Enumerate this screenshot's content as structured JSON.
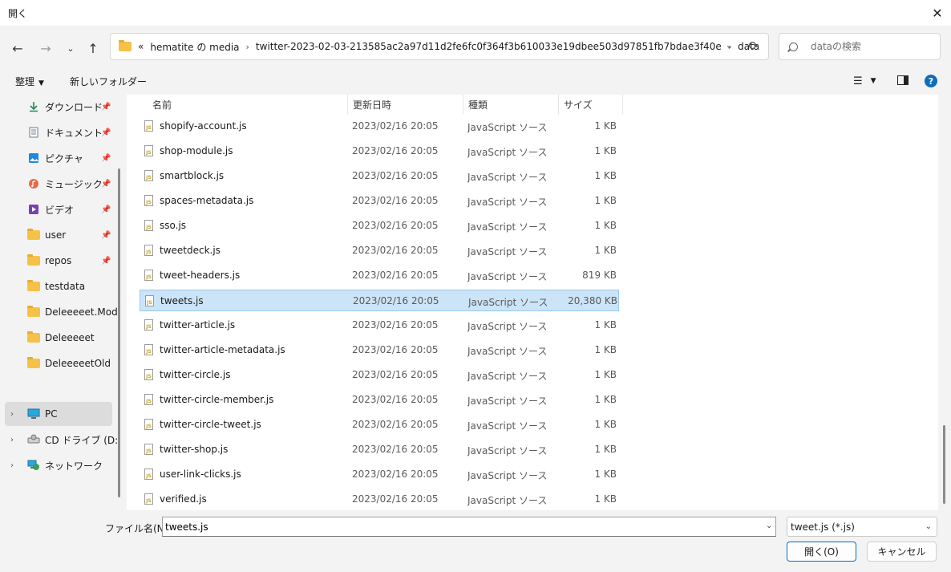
{
  "window": {
    "title": "開く"
  },
  "address": {
    "overflow": "«",
    "crumbs": [
      "hematite の media",
      "twitter-2023-02-03-213585ac2a97d11d2fe6fc0f364f3b610033e19dbee503d97851fb7bdae3f40e",
      "data"
    ]
  },
  "search": {
    "placeholder": "dataの検索"
  },
  "commands": {
    "organize": "整理",
    "new_folder": "新しいフォルダー"
  },
  "sidebar": {
    "items": [
      {
        "label": "ダウンロード",
        "icon": "download-icon",
        "pinned": true
      },
      {
        "label": "ドキュメント",
        "icon": "document-icon",
        "pinned": true
      },
      {
        "label": "ピクチャ",
        "icon": "pictures-icon",
        "pinned": true
      },
      {
        "label": "ミュージック",
        "icon": "music-icon",
        "pinned": true
      },
      {
        "label": "ビデオ",
        "icon": "video-icon",
        "pinned": true
      },
      {
        "label": "user",
        "icon": "folder-icon",
        "pinned": true
      },
      {
        "label": "repos",
        "icon": "folder-icon",
        "pinned": true
      },
      {
        "label": "testdata",
        "icon": "folder-icon",
        "pinned": false
      },
      {
        "label": "Deleeeeet.Mode",
        "icon": "folder-icon",
        "pinned": false
      },
      {
        "label": "Deleeeeet",
        "icon": "folder-icon",
        "pinned": false
      },
      {
        "label": "DeleeeeetOld",
        "icon": "folder-icon",
        "pinned": false
      }
    ],
    "devices": [
      {
        "label": "PC",
        "icon": "pc-icon",
        "selected": true
      },
      {
        "label": "CD ドライブ (D:) v",
        "icon": "cd-drive-icon",
        "selected": false
      },
      {
        "label": "ネットワーク",
        "icon": "network-icon",
        "selected": false
      }
    ]
  },
  "columns": {
    "name": "名前",
    "date": "更新日時",
    "type": "種類",
    "size": "サイズ"
  },
  "files": [
    {
      "name": "shopify-account.js",
      "date": "2023/02/16 20:05",
      "type": "JavaScript ソース フ...",
      "size": "1 KB"
    },
    {
      "name": "shop-module.js",
      "date": "2023/02/16 20:05",
      "type": "JavaScript ソース フ...",
      "size": "1 KB"
    },
    {
      "name": "smartblock.js",
      "date": "2023/02/16 20:05",
      "type": "JavaScript ソース フ...",
      "size": "1 KB"
    },
    {
      "name": "spaces-metadata.js",
      "date": "2023/02/16 20:05",
      "type": "JavaScript ソース フ...",
      "size": "1 KB"
    },
    {
      "name": "sso.js",
      "date": "2023/02/16 20:05",
      "type": "JavaScript ソース フ...",
      "size": "1 KB"
    },
    {
      "name": "tweetdeck.js",
      "date": "2023/02/16 20:05",
      "type": "JavaScript ソース フ...",
      "size": "1 KB"
    },
    {
      "name": "tweet-headers.js",
      "date": "2023/02/16 20:05",
      "type": "JavaScript ソース フ...",
      "size": "819 KB"
    },
    {
      "name": "tweets.js",
      "date": "2023/02/16 20:05",
      "type": "JavaScript ソース フ...",
      "size": "20,380 KB",
      "selected": true
    },
    {
      "name": "twitter-article.js",
      "date": "2023/02/16 20:05",
      "type": "JavaScript ソース フ...",
      "size": "1 KB"
    },
    {
      "name": "twitter-article-metadata.js",
      "date": "2023/02/16 20:05",
      "type": "JavaScript ソース フ...",
      "size": "1 KB"
    },
    {
      "name": "twitter-circle.js",
      "date": "2023/02/16 20:05",
      "type": "JavaScript ソース フ...",
      "size": "1 KB"
    },
    {
      "name": "twitter-circle-member.js",
      "date": "2023/02/16 20:05",
      "type": "JavaScript ソース フ...",
      "size": "1 KB"
    },
    {
      "name": "twitter-circle-tweet.js",
      "date": "2023/02/16 20:05",
      "type": "JavaScript ソース フ...",
      "size": "1 KB"
    },
    {
      "name": "twitter-shop.js",
      "date": "2023/02/16 20:05",
      "type": "JavaScript ソース フ...",
      "size": "1 KB"
    },
    {
      "name": "user-link-clicks.js",
      "date": "2023/02/16 20:05",
      "type": "JavaScript ソース フ...",
      "size": "1 KB"
    },
    {
      "name": "verified.js",
      "date": "2023/02/16 20:05",
      "type": "JavaScript ソース フ...",
      "size": "1 KB"
    }
  ],
  "footer": {
    "filename_label": "ファイル名(N):",
    "filename_value": "tweets.js",
    "filetype": "tweet.js (*.js)",
    "open_label": "開く(O)",
    "cancel_label": "キャンセル"
  },
  "colors": {
    "accent": "#0f6cbd",
    "selection": "#cce4f7",
    "folder": "#f5c247"
  }
}
